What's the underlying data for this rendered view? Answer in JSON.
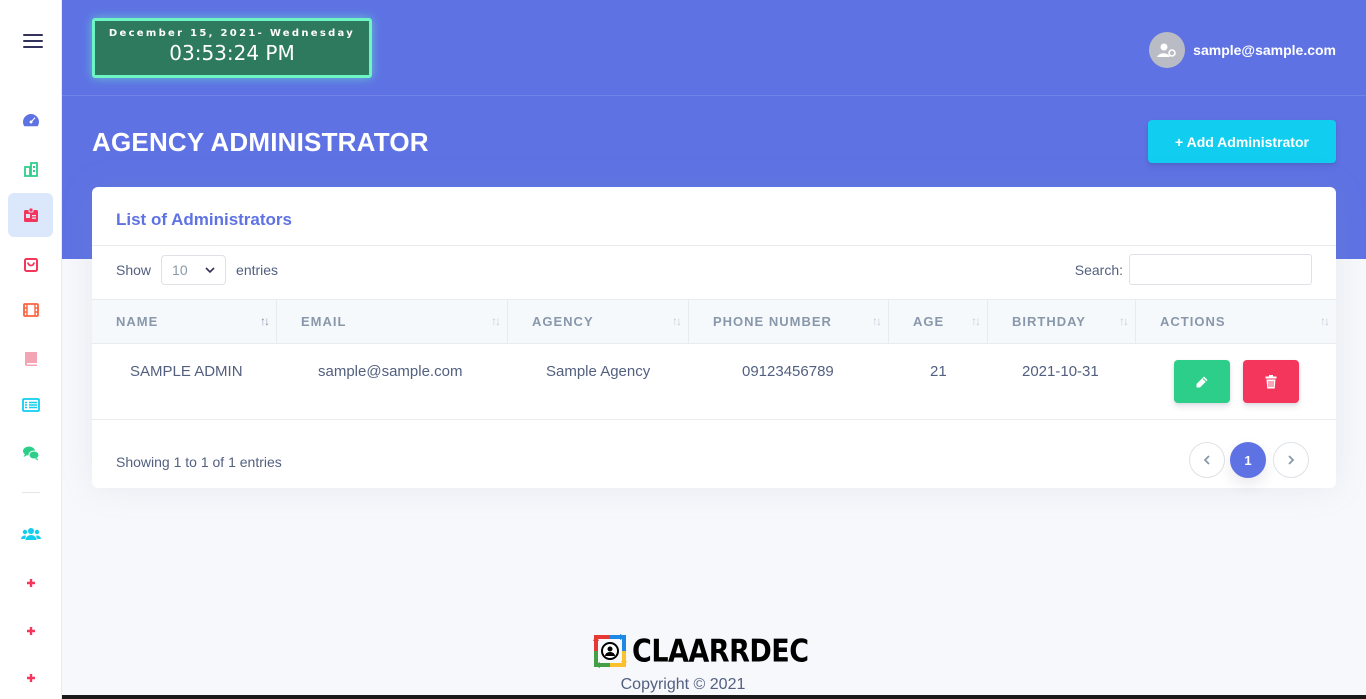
{
  "sidebar": {
    "items": [
      {
        "name": "dashboard",
        "icon": "gauge-icon",
        "color": "#5e72e4"
      },
      {
        "name": "buildings",
        "icon": "building-icon",
        "color": "#2dce89"
      },
      {
        "name": "administrators",
        "icon": "id-card-icon",
        "color": "#f5365c"
      },
      {
        "name": "shop",
        "icon": "shopping-bag-icon",
        "color": "#f5365c"
      },
      {
        "name": "media",
        "icon": "film-icon",
        "color": "#fb6340"
      },
      {
        "name": "book",
        "icon": "book-icon",
        "color": "#f3a4b5"
      },
      {
        "name": "list",
        "icon": "list-icon",
        "color": "#11cdef"
      },
      {
        "name": "chat",
        "icon": "comments-icon",
        "color": "#2dce89"
      },
      {
        "name": "users",
        "icon": "users-icon",
        "color": "#11cdef"
      },
      {
        "name": "add-1",
        "icon": "plus-icon",
        "color": "#f5365c"
      },
      {
        "name": "add-2",
        "icon": "plus-icon",
        "color": "#f5365c"
      },
      {
        "name": "add-3",
        "icon": "plus-icon",
        "color": "#f5365c"
      }
    ],
    "active": "administrators"
  },
  "clock": {
    "date": "December  15, 2021- Wednesday",
    "time": "03:53:24 PM"
  },
  "user": {
    "email": "sample@sample.com"
  },
  "page": {
    "title": "AGENCY ADMINISTRATOR",
    "add_button": "Add Administrator"
  },
  "card": {
    "title": "List of Administrators",
    "show_label": "Show",
    "entries_value": "10",
    "entries_label": "entries",
    "search_label": "Search:",
    "search_value": ""
  },
  "table": {
    "columns": [
      "NAME",
      "EMAIL",
      "AGENCY",
      "PHONE NUMBER",
      "AGE",
      "BIRTHDAY",
      "ACTIONS"
    ],
    "rows": [
      {
        "name": "SAMPLE ADMIN",
        "email": "sample@sample.com",
        "agency": "Sample Agency",
        "phone": "09123456789",
        "age": "21",
        "birthday": "2021-10-31"
      }
    ]
  },
  "pagination": {
    "info": "Showing 1 to 1 of 1 entries",
    "current": "1"
  },
  "footer": {
    "brand": "CLAARRDEC",
    "copyright": "Copyright © 2021"
  },
  "colors": {
    "primary": "#5e72e4",
    "info": "#11cdef",
    "success": "#2dce89",
    "danger": "#f5365c",
    "clock_bg": "#2e7a5e",
    "clock_border": "#6df5c4"
  }
}
